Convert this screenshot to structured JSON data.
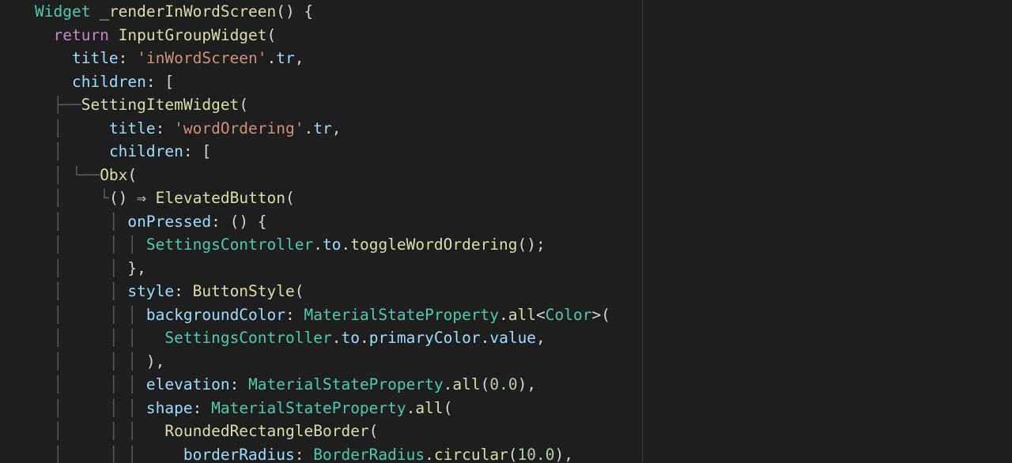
{
  "code": {
    "fn_ret_type": "Widget",
    "fn_name": "_renderInWordScreen",
    "kw_return": "return",
    "widget_InputGroup": "InputGroupWidget",
    "param_title": "title",
    "str_inWordScreen": "'inWordScreen'",
    "prop_tr": "tr",
    "param_children": "children",
    "widget_SettingItem": "SettingItemWidget",
    "str_wordOrdering": "'wordOrdering'",
    "widget_Obx": "Obx",
    "arrow": "⇒",
    "widget_ElevatedButton": "ElevatedButton",
    "param_onPressed": "onPressed",
    "cls_SettingsController": "SettingsController",
    "prop_to": "to",
    "fn_toggleWordOrdering": "toggleWordOrdering",
    "param_style": "style",
    "cls_ButtonStyle": "ButtonStyle",
    "param_backgroundColor": "backgroundColor",
    "cls_MaterialStateProperty": "MaterialStateProperty",
    "fn_all": "all",
    "type_Color": "Color",
    "prop_primaryColor": "primaryColor",
    "prop_value": "value",
    "param_elevation": "elevation",
    "num_zero": "0.0",
    "param_shape": "shape",
    "cls_RoundedRectangleBorder": "RoundedRectangleBorder",
    "param_borderRadius": "borderRadius",
    "cls_BorderRadius": "BorderRadius",
    "fn_circular": "circular",
    "num_ten": "10.0"
  }
}
